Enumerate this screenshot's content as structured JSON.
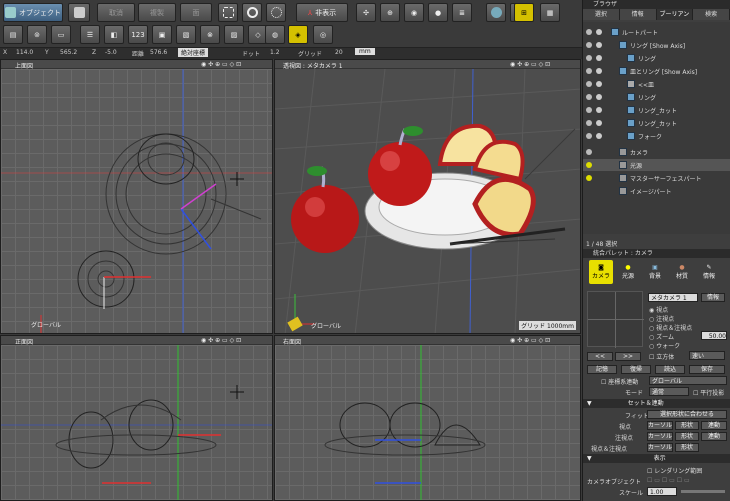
{
  "toolbar": {
    "object_label": "オブジェクト",
    "undo": "取消",
    "repeat": "複製",
    "face": "面",
    "hide": "非表示"
  },
  "status": {
    "x_label": "X",
    "x": "114.0",
    "y_label": "Y",
    "y": "565.2",
    "z_label": "Z",
    "z": "-5.0",
    "dist_label": "距離",
    "dist": "576.6",
    "coord": "絶対座標",
    "dot_label": "ドット",
    "dot": "1.2",
    "grid_label": "グリッド",
    "grid": "20",
    "unit": "mm"
  },
  "views": {
    "top": "上面図",
    "persp": "透視図 : メタカメラ 1",
    "front": "正面図",
    "right": "右面図",
    "global": "グローバル",
    "grid_readout": "グリッド 1000mm"
  },
  "browser": {
    "title": "ブラウザ",
    "tabs": [
      "選択",
      "情報",
      "ブーリアン",
      "検索"
    ],
    "items": [
      {
        "label": "ルートパート"
      },
      {
        "label": "リング [Show Axis]"
      },
      {
        "label": "リング"
      },
      {
        "label": "皿とリング [Show Axis]"
      },
      {
        "label": "<<皿"
      },
      {
        "label": "リング"
      },
      {
        "label": "リング_カット"
      },
      {
        "label": "リング_カット"
      },
      {
        "label": "フォーク"
      },
      {
        "label": "カメラ"
      },
      {
        "label": "光源"
      },
      {
        "label": "マスターサーフェスパート"
      },
      {
        "label": "イメージパート"
      }
    ],
    "count": "1 / 48 選択"
  },
  "palette": {
    "title": "統合パレット : カメラ",
    "cats": [
      {
        "label": "カメラ"
      },
      {
        "label": "光源"
      },
      {
        "label": "背景"
      },
      {
        "label": "材質"
      },
      {
        "label": "情報"
      }
    ],
    "camera_select": "メタカメラ 1",
    "camera_btn": "情報",
    "radios": [
      "視点",
      "注視点",
      "視点＆注視点",
      "ズーム",
      "ウォーク"
    ],
    "zoom_value": "50.00",
    "cube_label": "立方体",
    "speed": "速い",
    "buttons": [
      "記憶",
      "復帰",
      "読込",
      "保存"
    ],
    "coord_label": "座標系連動",
    "coord_value": "グローバル",
    "mode_label": "モード",
    "mode_value": "通常",
    "parallel": "平行投影",
    "set_section": "セット＆連動",
    "fit_label": "フィット",
    "fit_value": "選択形状に合わせる",
    "rows": [
      {
        "label": "視点",
        "a": "カーソル",
        "b": "形状",
        "c": "連動"
      },
      {
        "label": "注視点",
        "a": "カーソル",
        "b": "形状",
        "c": "連動"
      },
      {
        "label": "視点＆注視点",
        "a": "カーソル",
        "b": "形状",
        "c": ""
      }
    ],
    "display_section": "表示",
    "render_range": "レンダリング範囲",
    "cam_obj": "カメラオブジェクト",
    "scale_label": "スケール",
    "scale_value": "1.00"
  }
}
